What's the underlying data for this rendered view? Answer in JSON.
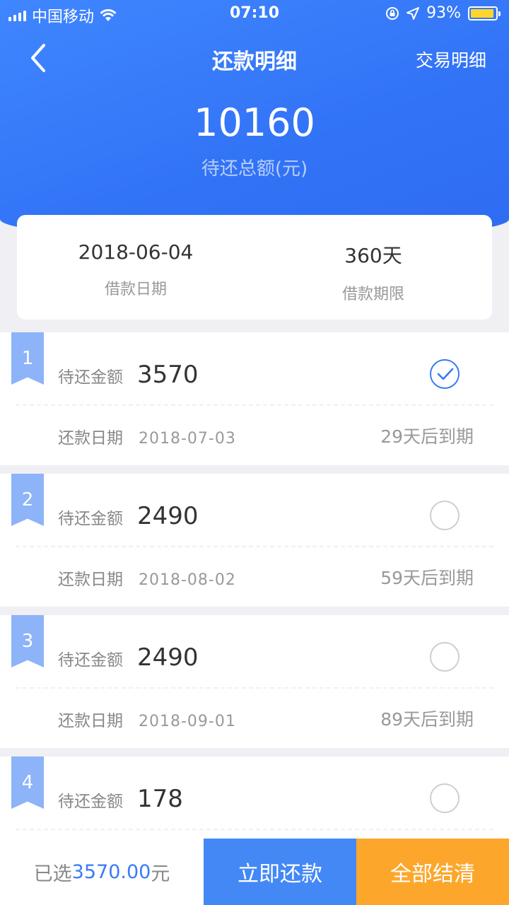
{
  "status_bar": {
    "carrier": "中国移动",
    "time": "07:10",
    "battery_text": "93%",
    "battery_level": 0.93,
    "battery_color": "#ffd52c"
  },
  "nav": {
    "title": "还款明细",
    "right_link": "交易明细",
    "back_icon": "chevron-left-icon"
  },
  "summary": {
    "total_amount": "10160",
    "total_label": "待还总额(元)",
    "loan_date": "2018-06-04",
    "loan_date_label": "借款日期",
    "loan_term": "360天",
    "loan_term_label": "借款期限"
  },
  "installments": [
    {
      "index": "1",
      "amount_label": "待还金额",
      "amount": "3570",
      "date_label": "还款日期",
      "date": "2018-07-03",
      "due": "29天后到期",
      "selected": true
    },
    {
      "index": "2",
      "amount_label": "待还金额",
      "amount": "2490",
      "date_label": "还款日期",
      "date": "2018-08-02",
      "due": "59天后到期",
      "selected": false
    },
    {
      "index": "3",
      "amount_label": "待还金额",
      "amount": "2490",
      "date_label": "还款日期",
      "date": "2018-09-01",
      "due": "89天后到期",
      "selected": false
    },
    {
      "index": "4",
      "amount_label": "待还金额",
      "amount": "178",
      "date_label": "",
      "date": "",
      "due": "",
      "selected": false
    }
  ],
  "bottom_bar": {
    "selected_prefix": "已选",
    "selected_amount": "3570.00",
    "selected_suffix": "元",
    "pay_now": "立即还款",
    "pay_all": "全部结清"
  },
  "colors": {
    "primary": "#3273f6",
    "accent_orange": "#fca72c",
    "ribbon": "#8db3f9"
  }
}
